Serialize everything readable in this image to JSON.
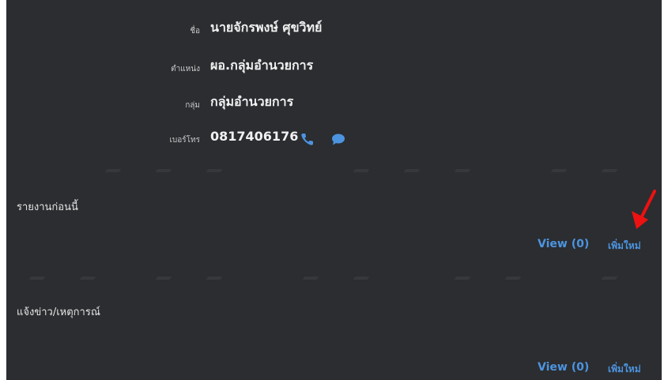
{
  "profile": {
    "name_label": "ชื่อ",
    "name_value": "นายจักรพงษ์ ศุขวิทย์",
    "position_label": "ตำแหน่ง",
    "position_value": "ผอ.กลุ่มอำนวยการ",
    "group_label": "กลุ่ม",
    "group_value": "กลุ่มอำนวยการ",
    "phone_label": "เบอร์โทร",
    "phone_value": "0817406176",
    "phone_icon": "phone-icon",
    "chat_icon": "chat-bubble-icon"
  },
  "sections": [
    {
      "title": "รายงานก่อนนี้",
      "view_label": "View (0)",
      "add_label": "เพิ่มใหม่"
    },
    {
      "title": "แจ้งข่าว/เหตุการณ์",
      "view_label": "View (0)",
      "add_label": "เพิ่มใหม่"
    }
  ],
  "colors": {
    "background": "#2b2d30",
    "link": "#4d94e0",
    "annotation_arrow": "#ee1111"
  }
}
